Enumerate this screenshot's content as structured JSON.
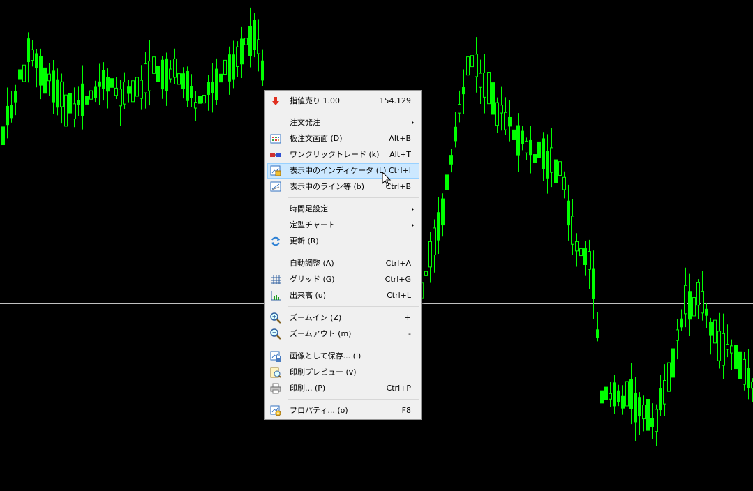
{
  "chart": {
    "background": "#000000",
    "candle_color": "#00ff00",
    "price_line_color": "#c0c0c0"
  },
  "menu": {
    "items": [
      {
        "label": "指値売り 1.00",
        "value": "154.129",
        "icon": "sell-arrow-icon"
      },
      {
        "label": "注文発注",
        "submenu": true
      },
      {
        "label": "板注文画面 (D)",
        "shortcut": "Alt+B",
        "icon": "order-board-icon"
      },
      {
        "label": "ワンクリックトレード (k)",
        "shortcut": "Alt+T",
        "icon": "one-click-trade-icon"
      },
      {
        "label": "表示中のインディケータ (L)",
        "shortcut": "Ctrl+I",
        "icon": "indicators-icon",
        "highlighted": true
      },
      {
        "label": "表示中のライン等 (b)",
        "shortcut": "Ctrl+B",
        "icon": "objects-icon"
      },
      {
        "label": "時間足設定",
        "submenu": true
      },
      {
        "label": "定型チャート",
        "submenu": true
      },
      {
        "label": "更新 (R)",
        "icon": "refresh-icon"
      },
      {
        "label": "自動調整 (A)",
        "shortcut": "Ctrl+A"
      },
      {
        "label": "グリッド (G)",
        "shortcut": "Ctrl+G",
        "icon": "grid-icon"
      },
      {
        "label": "出来高 (u)",
        "shortcut": "Ctrl+L",
        "icon": "volume-icon"
      },
      {
        "label": "ズームイン (Z)",
        "shortcut": "+",
        "icon": "zoom-in-icon"
      },
      {
        "label": "ズームアウト (m)",
        "shortcut": "-",
        "icon": "zoom-out-icon"
      },
      {
        "label": "画像として保存... (i)",
        "icon": "save-image-icon"
      },
      {
        "label": "印刷プレビュー (v)",
        "icon": "print-preview-icon"
      },
      {
        "label": "印刷... (P)",
        "shortcut": "Ctrl+P",
        "icon": "print-icon"
      },
      {
        "label": "プロパティ... (o)",
        "shortcut": "F8",
        "icon": "properties-icon"
      }
    ]
  }
}
